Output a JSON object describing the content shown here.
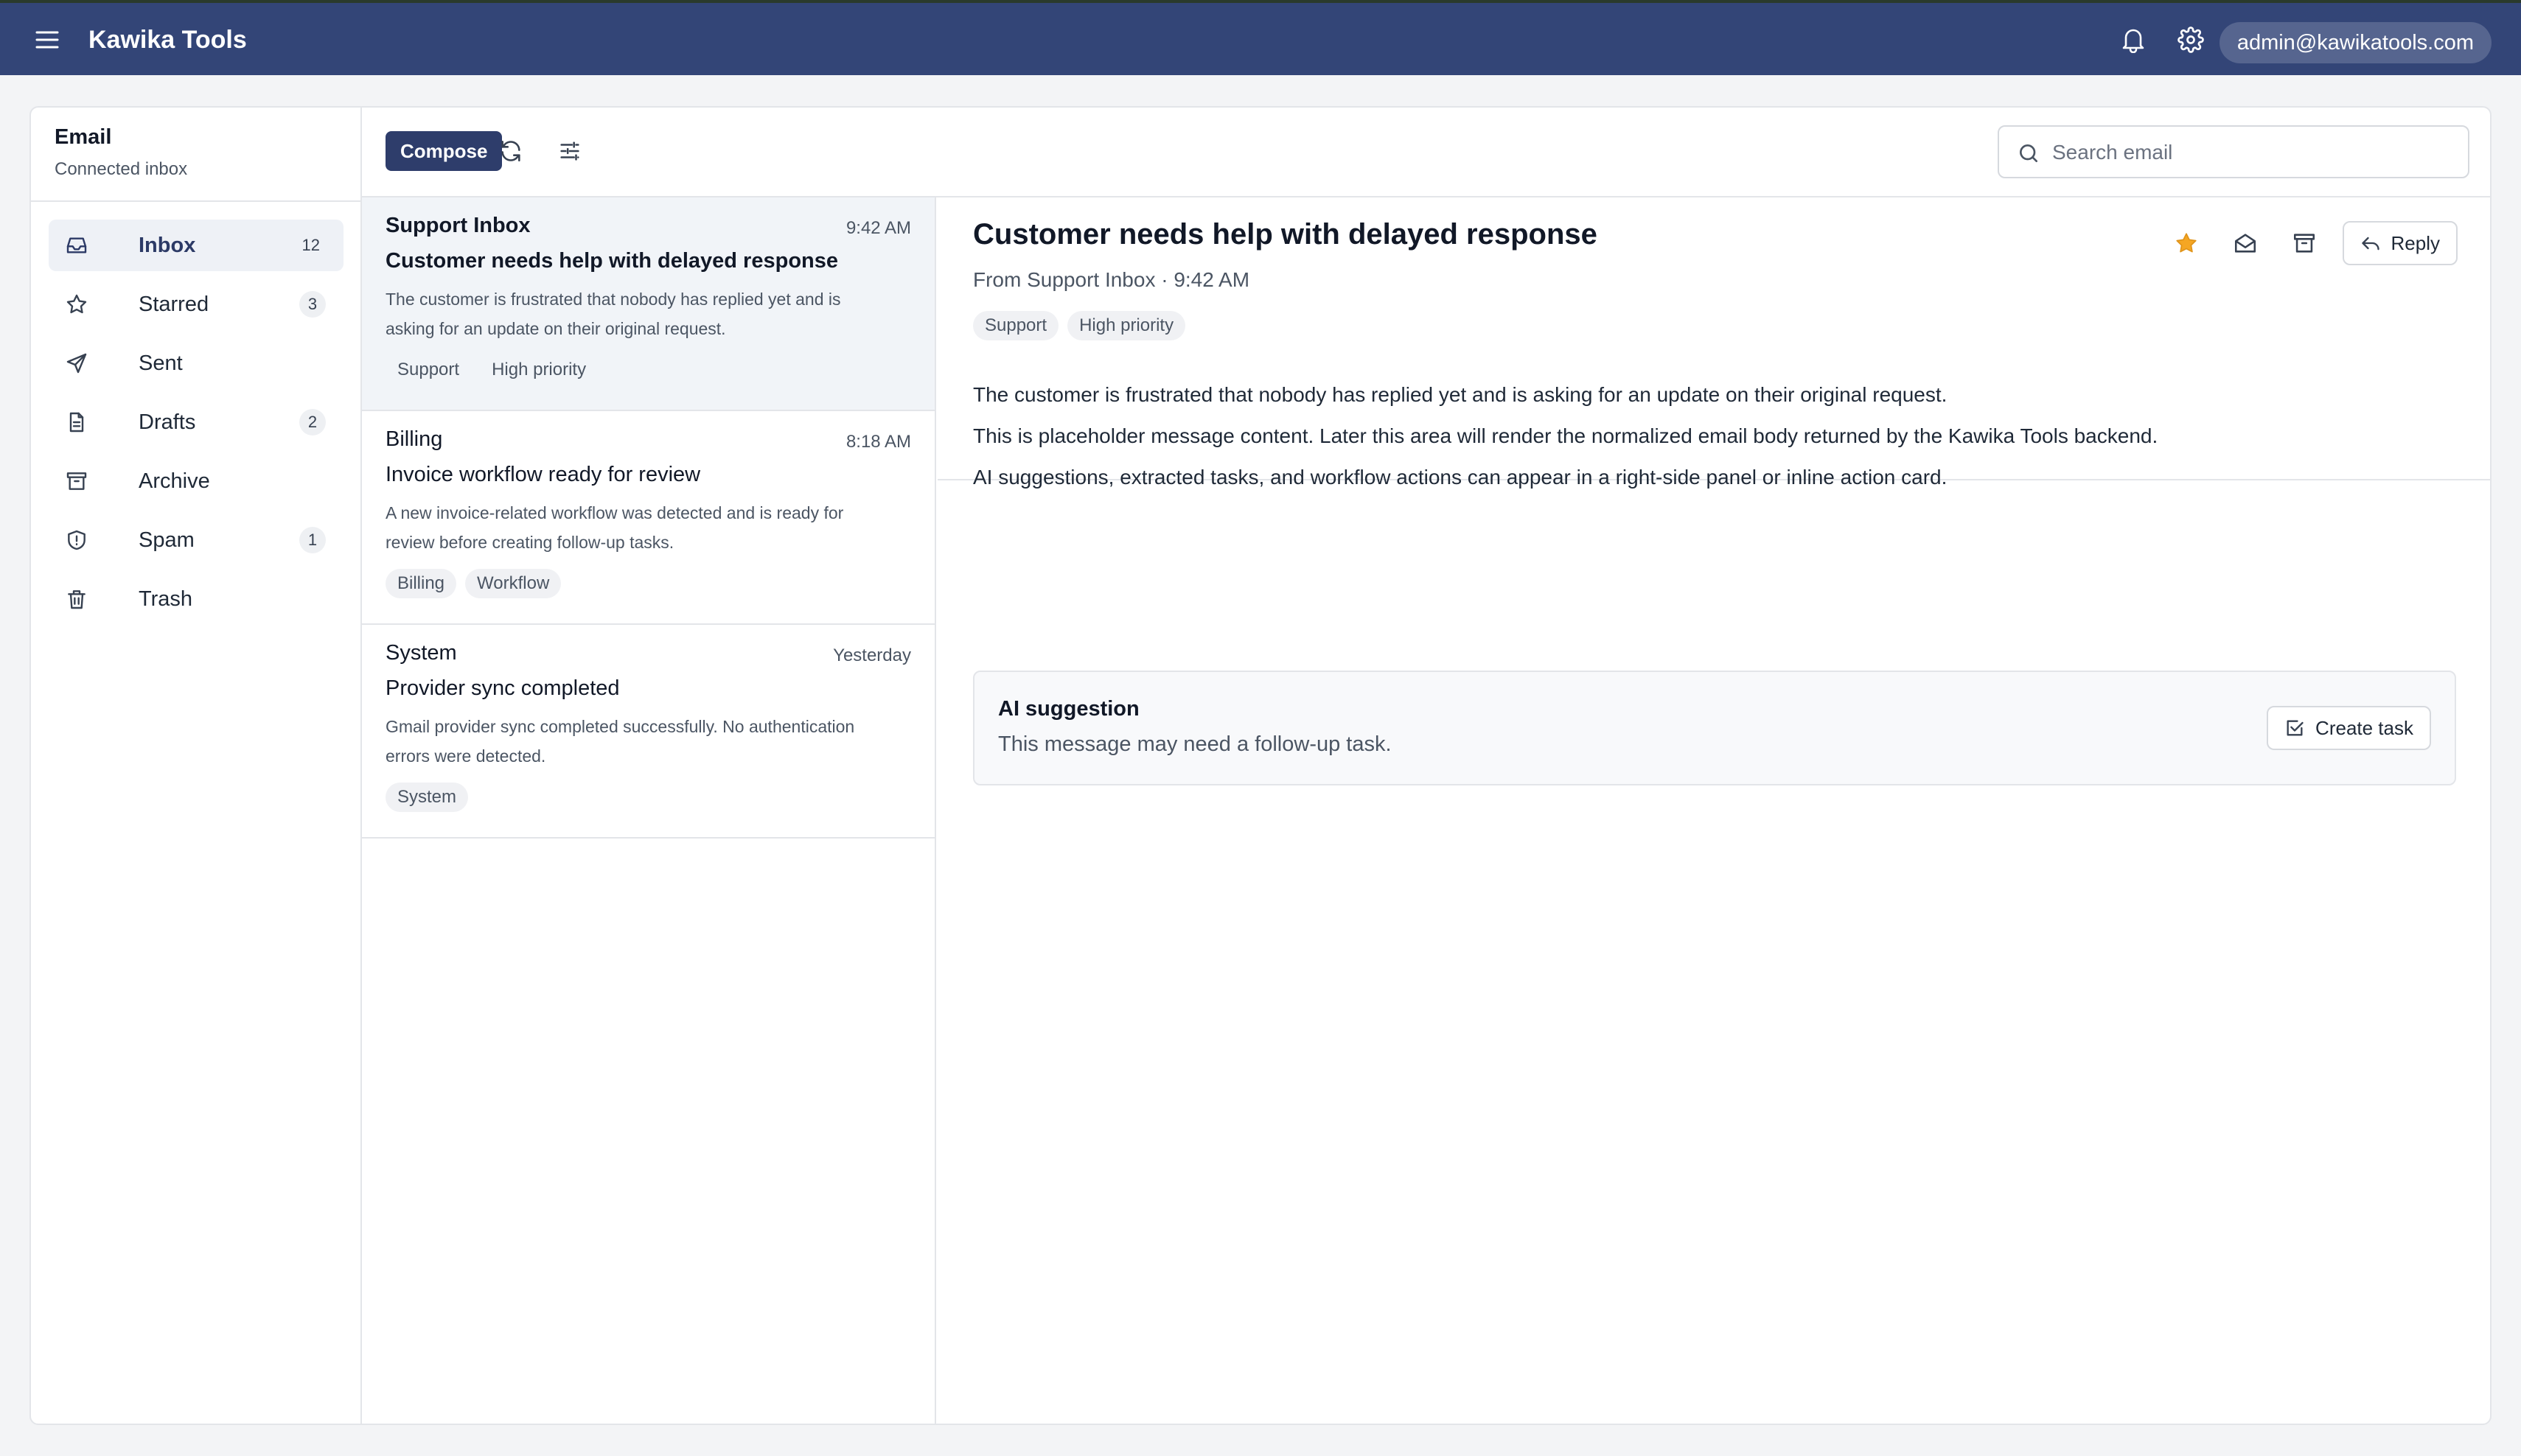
{
  "app": {
    "title": "Kawika Tools",
    "user_email": "admin@kawikatools.com"
  },
  "icons": {
    "menu": "hamburger-menu-icon",
    "notifications": "bell-icon",
    "settings": "gear-icon"
  },
  "colors": {
    "topbar": "#334577",
    "accent": "#2e3d6b",
    "star": "#f5a623"
  },
  "sidebar": {
    "title": "Email",
    "subtitle": "Connected inbox",
    "items": [
      {
        "label": "Inbox",
        "icon": "inbox-icon",
        "count": "12",
        "active": true
      },
      {
        "label": "Starred",
        "icon": "star-icon",
        "count": "3"
      },
      {
        "label": "Sent",
        "icon": "send-icon",
        "count": ""
      },
      {
        "label": "Drafts",
        "icon": "draft-icon",
        "count": "2"
      },
      {
        "label": "Archive",
        "icon": "archive-icon",
        "count": ""
      },
      {
        "label": "Spam",
        "icon": "shield-icon",
        "count": "1"
      },
      {
        "label": "Trash",
        "icon": "trash-icon",
        "count": ""
      }
    ]
  },
  "toolbar": {
    "compose_label": "Compose",
    "refresh_icon": "refresh-icon",
    "filter_icon": "filter-sliders-icon",
    "search_placeholder": "Search email"
  },
  "messages": [
    {
      "from": "Support Inbox",
      "time": "9:42 AM",
      "subject": "Customer needs help with delayed response",
      "preview": "The customer is frustrated that nobody has replied yet and is asking for an update on their original request.",
      "tags": [
        "Support",
        "High priority"
      ],
      "selected": true
    },
    {
      "from": "Billing",
      "time": "8:18 AM",
      "subject": "Invoice workflow ready for review",
      "preview": "A new invoice-related workflow was detected and is ready for review before creating follow-up tasks.",
      "tags": [
        "Billing",
        "Workflow"
      ]
    },
    {
      "from": "System",
      "time": "Yesterday",
      "subject": "Provider sync completed",
      "preview": "Gmail provider sync completed successfully. No authentication errors were detected.",
      "tags": [
        "System"
      ]
    }
  ],
  "reader": {
    "subject": "Customer needs help with delayed response",
    "meta": "From Support Inbox · 9:42 AM",
    "tags": [
      "Support",
      "High priority"
    ],
    "reply_label": "Reply",
    "body": [
      "The customer is frustrated that nobody has replied yet and is asking for an update on their original request.",
      "This is placeholder message content. Later this area will render the normalized email body returned by the Kawika Tools backend.",
      "AI suggestions, extracted tasks, and workflow actions can appear in a right-side panel or inline action card."
    ],
    "ai": {
      "title": "AI suggestion",
      "text": "This message may need a follow-up task.",
      "button_label": "Create task"
    }
  }
}
